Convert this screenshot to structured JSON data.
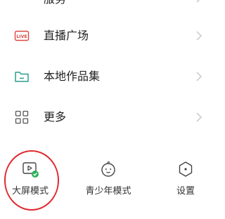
{
  "menu": {
    "items": [
      {
        "label": "直播广场",
        "icon": "live-icon"
      },
      {
        "label": "本地作品集",
        "icon": "folder-icon"
      },
      {
        "label": "更多",
        "icon": "grid-icon"
      }
    ],
    "top_partial_label": "服务"
  },
  "bottom_bar": {
    "items": [
      {
        "label": "大屏模式",
        "icon": "screen-mode-icon",
        "highlighted": true
      },
      {
        "label": "青少年模式",
        "icon": "teen-mode-icon"
      },
      {
        "label": "设置",
        "icon": "settings-icon"
      }
    ],
    "live_badge": "LIVE"
  },
  "colors": {
    "accent_red": "#d9473f",
    "folder_green": "#2a9d8f",
    "check_green": "#2bb25a",
    "chevron": "#c8c8c8",
    "annotation_circle": "#e0282e"
  }
}
